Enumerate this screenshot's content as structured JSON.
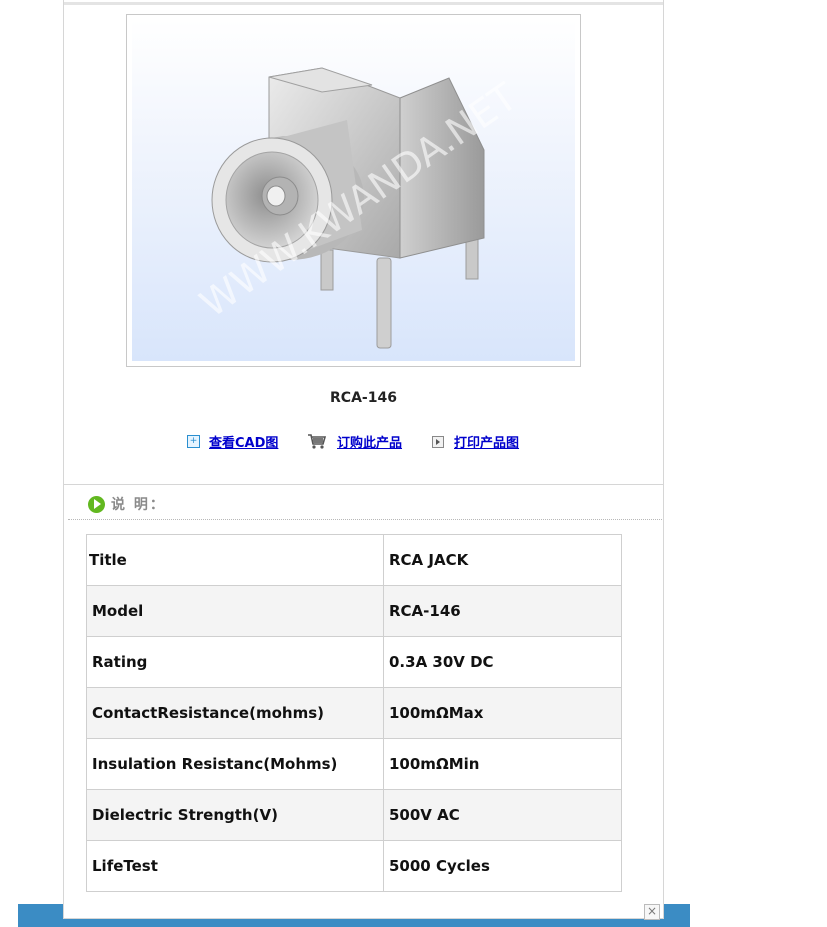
{
  "product": {
    "name": "RCA-146",
    "image_watermark": "WWW.KWANDA.NET"
  },
  "actions": {
    "cad_label": "查看CAD图",
    "order_label": "订购此产品",
    "print_label": "打印产品图"
  },
  "section": {
    "title": "说 明："
  },
  "specs": [
    {
      "key": "Title",
      "value": "RCA JACK"
    },
    {
      "key": "Model",
      "value": "RCA-146"
    },
    {
      "key": "Rating",
      "value": "0.3A 30V DC"
    },
    {
      "key": "ContactResistance(mohms)",
      "value": "100mΩMax"
    },
    {
      "key": "Insulation Resistanc(Mohms)",
      "value": "100mΩMin"
    },
    {
      "key": "Dielectric Strength(V)",
      "value": "500V AC"
    },
    {
      "key": "LifeTest",
      "value": "5000 Cycles"
    }
  ],
  "close_glyph": "×",
  "colors": {
    "link": "#0000cc",
    "bar": "#3b8cc4",
    "section_icon": "#62b820"
  }
}
